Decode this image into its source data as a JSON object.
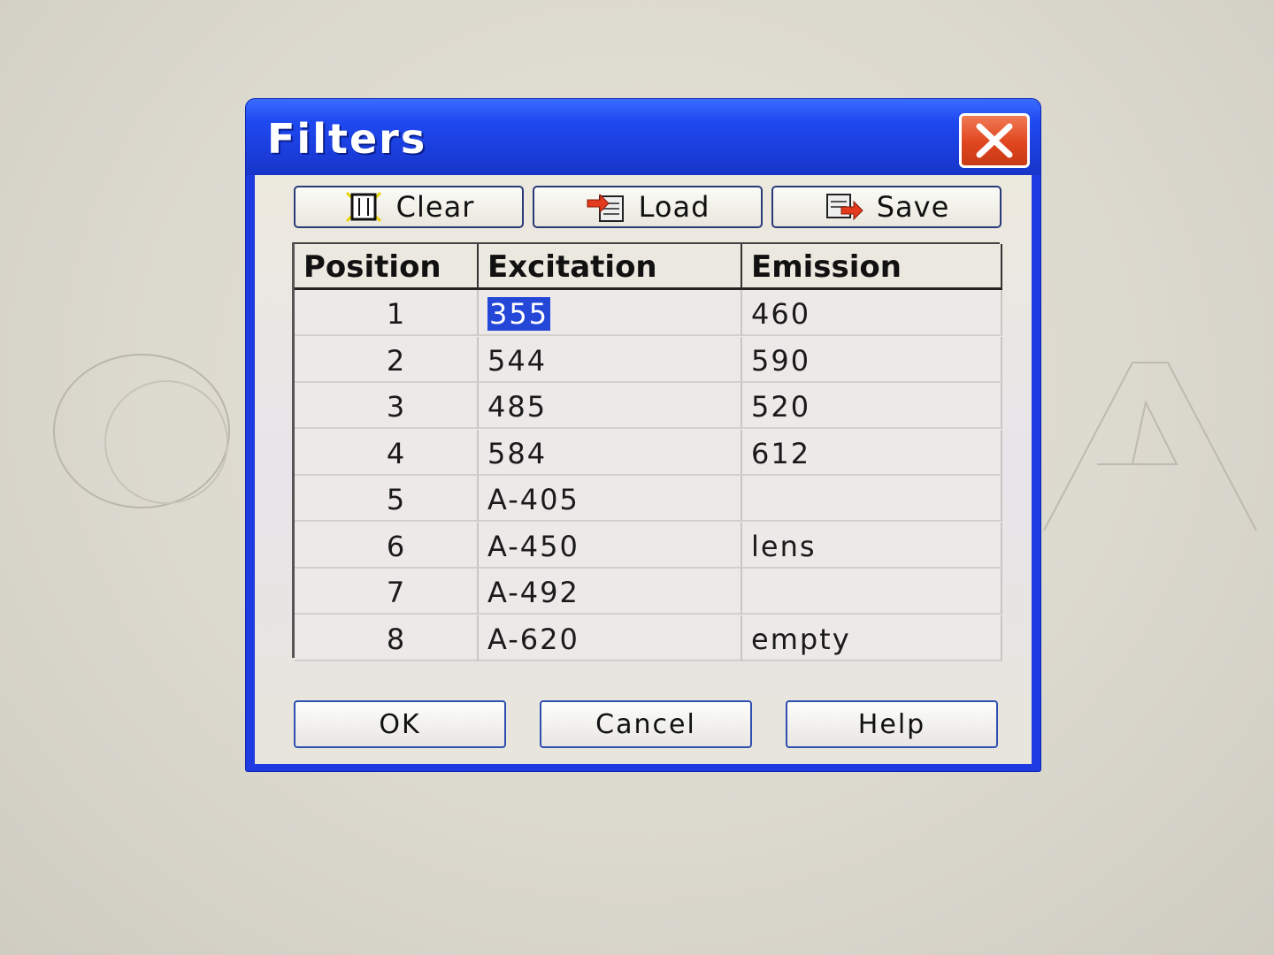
{
  "window": {
    "title": "Filters"
  },
  "toolbar": {
    "clear_label": "Clear",
    "load_label": "Load",
    "save_label": "Save"
  },
  "table": {
    "columns": [
      "Position",
      "Excitation",
      "Emission"
    ],
    "rows": [
      {
        "position": "1",
        "excitation": "355",
        "emission": "460"
      },
      {
        "position": "2",
        "excitation": "544",
        "emission": "590"
      },
      {
        "position": "3",
        "excitation": "485",
        "emission": "520"
      },
      {
        "position": "4",
        "excitation": "584",
        "emission": "612"
      },
      {
        "position": "5",
        "excitation": "A-405",
        "emission": ""
      },
      {
        "position": "6",
        "excitation": "A-450",
        "emission": "lens"
      },
      {
        "position": "7",
        "excitation": "A-492",
        "emission": ""
      },
      {
        "position": "8",
        "excitation": "A-620",
        "emission": "empty"
      }
    ]
  },
  "buttons": {
    "ok_label": "OK",
    "cancel_label": "Cancel",
    "help_label": "Help"
  },
  "icons": {
    "close": "close-icon",
    "clear": "clear-icon",
    "load": "load-icon",
    "save": "save-icon"
  },
  "colors": {
    "title_bar": "#1f49f0",
    "close_button": "#e0461f",
    "selection": "#2447d8"
  }
}
